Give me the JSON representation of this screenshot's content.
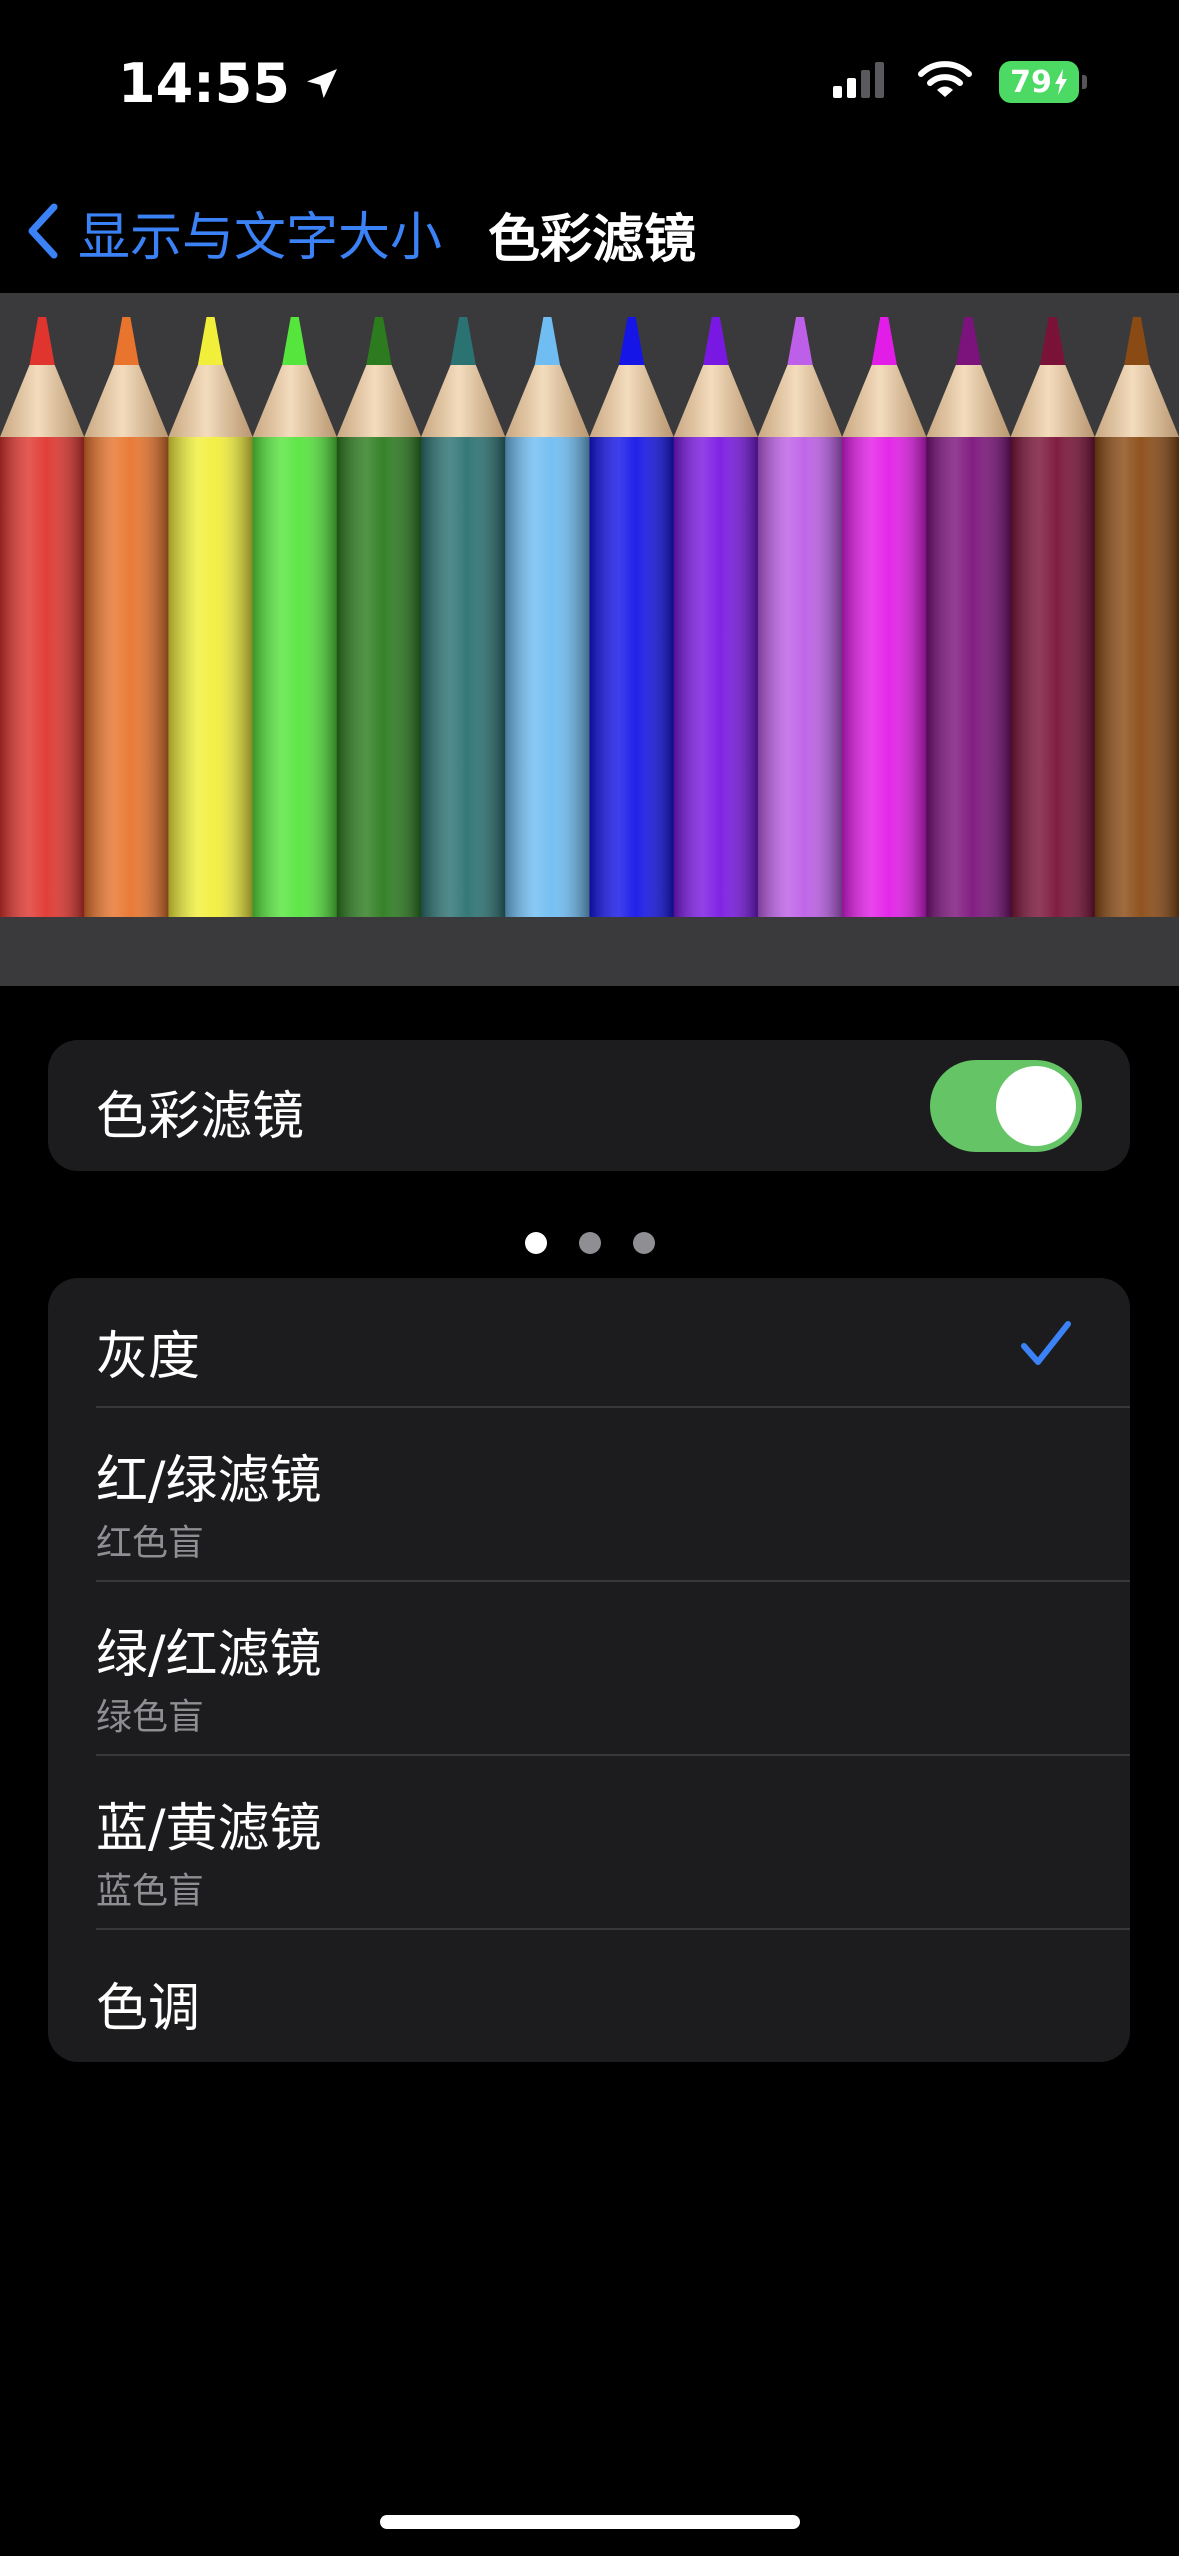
{
  "status_bar": {
    "time": "14:55",
    "battery_level": "79",
    "icons": [
      "location-arrow-icon",
      "cellular-signal-icon",
      "wifi-icon",
      "battery-charging-icon"
    ]
  },
  "nav": {
    "back_label": "显示与文字大小",
    "title": "色彩滤镜"
  },
  "preview": {
    "pencil_colors": [
      "#e0352f",
      "#e8742d",
      "#f2ef3b",
      "#56e53d",
      "#2c7c1f",
      "#2b7272",
      "#6fbdf2",
      "#1515e8",
      "#7a18e3",
      "#bd5fe8",
      "#e31de8",
      "#7c127c",
      "#7a1238",
      "#8a4a14"
    ],
    "page_count": 3,
    "active_page": 1
  },
  "toggle": {
    "label": "色彩滤镜",
    "on": true,
    "on_color": "#65c466"
  },
  "filters": [
    {
      "label": "灰度",
      "sublabel": "",
      "selected": true
    },
    {
      "label": "红/绿滤镜",
      "sublabel": "红色盲",
      "selected": false
    },
    {
      "label": "绿/红滤镜",
      "sublabel": "绿色盲",
      "selected": false
    },
    {
      "label": "蓝/黄滤镜",
      "sublabel": "蓝色盲",
      "selected": false
    },
    {
      "label": "色调",
      "sublabel": "",
      "selected": false
    }
  ],
  "colors": {
    "accent": "#3b82f6",
    "background": "#000000",
    "group_background": "#1c1c1e",
    "secondary_text": "#8e8e93"
  }
}
